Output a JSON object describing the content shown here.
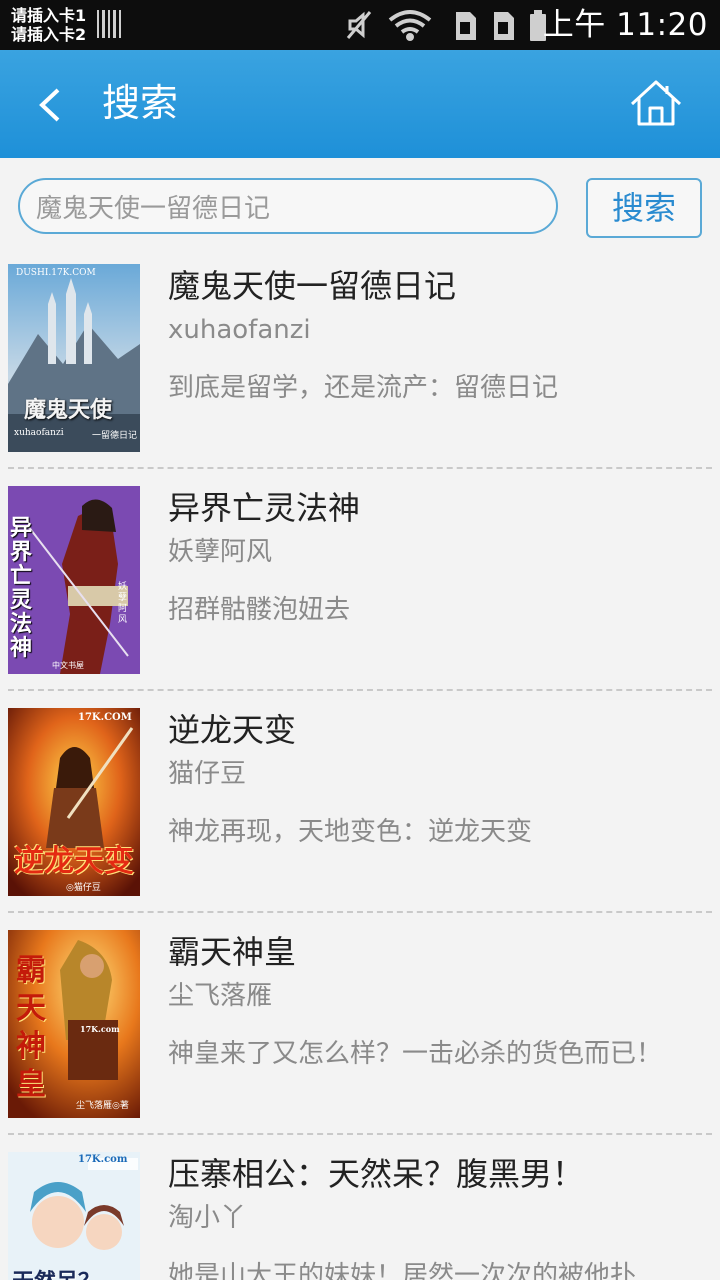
{
  "status_bar": {
    "sim1": "请插入卡1",
    "sim2": "请插入卡2",
    "time": "上午 11:20"
  },
  "header": {
    "title": "搜索"
  },
  "search": {
    "value": "魔鬼天使一留德日记",
    "button_label": "搜索"
  },
  "books": [
    {
      "title": "魔鬼天使一留德日记",
      "author": "xuhaofanzi",
      "description": "到底是留学，还是流产：留德日记",
      "cover_header": "DUSHI.17K.COM",
      "cover_title": "魔鬼天使",
      "cover_author": "xuhaofanzi",
      "cover_sub": "一留德日记"
    },
    {
      "title": "异界亡灵法神",
      "author": "妖孽阿风",
      "description": "招群骷髅泡妞去",
      "cover_title": "异界亡灵法神",
      "cover_author": "妖孽阿风",
      "cover_badge": "中文书屋"
    },
    {
      "title": "逆龙天变",
      "author": "猫仔豆",
      "description": "神龙再现，天地变色：逆龙天变",
      "cover_header": "17K.COM",
      "cover_title": "逆龙天变",
      "cover_author": "◎猫仔豆"
    },
    {
      "title": "霸天神皇",
      "author": "尘飞落雁",
      "description": "神皇来了又怎么样？一击必杀的货色而已！",
      "cover_title": "霸天神皇",
      "cover_author": "尘飞落雁◎著",
      "cover_header": "17K.com"
    },
    {
      "title": "压寨相公：天然呆？腹黑男！",
      "author": "淘小丫",
      "description": "她是山大王的妹妹！居然一次次的被他扑",
      "cover_header": "17K.com",
      "cover_title": "天然呆？"
    }
  ]
}
